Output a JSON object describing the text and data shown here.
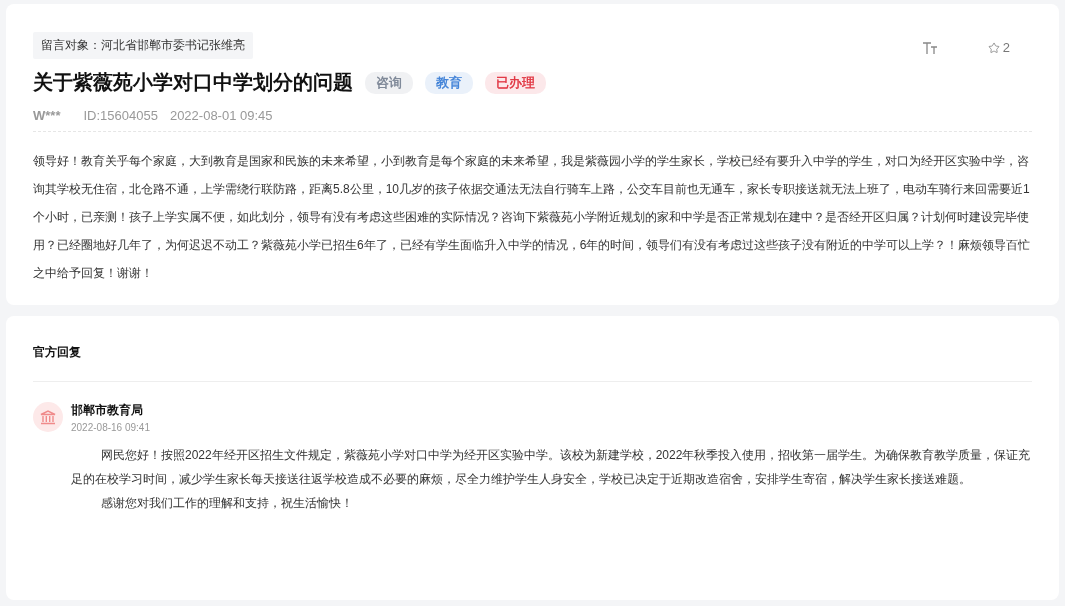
{
  "message": {
    "target": "留言对象：河北省邯郸市委书记张维亮",
    "title": "关于紫薇苑小学对口中学划分的问题",
    "tags": [
      {
        "label": "咨询",
        "color": "#7a8494"
      },
      {
        "label": "教育",
        "color": "#3c7fd6"
      },
      {
        "label": "已办理",
        "color": "#e0303d"
      }
    ],
    "author": "W***",
    "id": "ID:15604055",
    "time": "2022-08-01 09:45",
    "favorites": "2",
    "body": "领导好！教育关乎每个家庭，大到教育是国家和民族的未来希望，小到教育是每个家庭的未来希望，我是紫薇园小学的学生家长，学校已经有要升入中学的学生，对口为经开区实验中学，咨询其学校无住宿，北仓路不通，上学需绕行联防路，距离5.8公里，10几岁的孩子依据交通法无法自行骑车上路，公交车目前也无通车，家长专职接送就无法上班了，电动车骑行来回需要近1个小时，已亲测！孩子上学实属不便，如此划分，领导有没有考虑这些困难的实际情况？咨询下紫薇苑小学附近规划的家和中学是否正常规划在建中？是否经开区归属？计划何时建设完毕使用？已经圈地好几年了，为何迟迟不动工？紫薇苑小学已招生6年了，已经有学生面临升入中学的情况，6年的时间，领导们有没有考虑过这些孩子没有附近的中学可以上学？！麻烦领导百忙之中给予回复！谢谢！"
  },
  "reply": {
    "heading": "官方回复",
    "department": "邯郸市教育局",
    "time": "2022-08-16 09:41",
    "paragraphs": [
      "网民您好！按照2022年经开区招生文件规定，紫薇苑小学对口中学为经开区实验中学。该校为新建学校，2022年秋季投入使用，招收第一届学生。为确保教育教学质量，保证充足的在校学习时间，减少学生家长每天接送往返学校造成不必要的麻烦，尽全力维护学生人身安全，学校已决定于近期改造宿舍，安排学生寄宿，解决学生家长接送难题。",
      "感谢您对我们工作的理解和支持，祝生活愉快！"
    ]
  }
}
